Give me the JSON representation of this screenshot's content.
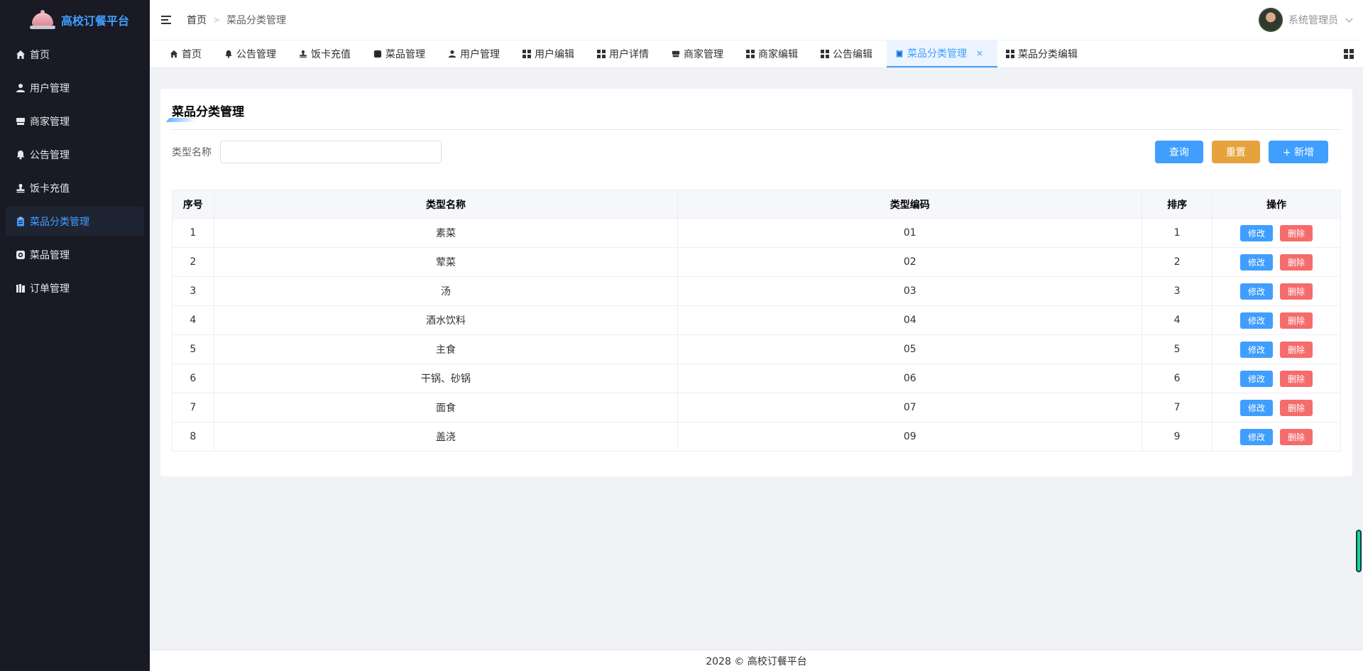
{
  "app": {
    "title": "高校订餐平台"
  },
  "sidebar": {
    "items": [
      {
        "label": "首页",
        "icon": "home-icon",
        "active": false
      },
      {
        "label": "用户管理",
        "icon": "user-icon",
        "active": false
      },
      {
        "label": "商家管理",
        "icon": "shop-icon",
        "active": false
      },
      {
        "label": "公告管理",
        "icon": "bell-icon",
        "active": false
      },
      {
        "label": "饭卡充值",
        "icon": "stamp-icon",
        "active": false
      },
      {
        "label": "菜品分类管理",
        "icon": "clipboard-icon",
        "active": true
      },
      {
        "label": "菜品管理",
        "icon": "dish-icon",
        "active": false
      },
      {
        "label": "订单管理",
        "icon": "order-icon",
        "active": false
      }
    ]
  },
  "header": {
    "breadcrumb": [
      "首页",
      "菜品分类管理"
    ],
    "user_name": "系统管理员"
  },
  "tabs": [
    {
      "label": "首页",
      "icon": "home-icon"
    },
    {
      "label": "公告管理",
      "icon": "bell-icon"
    },
    {
      "label": "饭卡充值",
      "icon": "stamp-icon"
    },
    {
      "label": "菜品管理",
      "icon": "dish-icon"
    },
    {
      "label": "用户管理",
      "icon": "user-icon"
    },
    {
      "label": "用户编辑",
      "icon": "grid-icon"
    },
    {
      "label": "用户详情",
      "icon": "grid-icon"
    },
    {
      "label": "商家管理",
      "icon": "shop-icon"
    },
    {
      "label": "商家编辑",
      "icon": "grid-icon"
    },
    {
      "label": "公告编辑",
      "icon": "grid-icon"
    },
    {
      "label": "菜品分类管理",
      "icon": "clipboard-icon",
      "active": true,
      "close": "×"
    },
    {
      "label": "菜品分类编辑",
      "icon": "grid-icon"
    }
  ],
  "page": {
    "title": "菜品分类管理",
    "search": {
      "label": "类型名称",
      "value": "",
      "placeholder": ""
    },
    "buttons": {
      "query": "查询",
      "reset": "重置",
      "add": "+ 新增"
    }
  },
  "table": {
    "columns": [
      "序号",
      "类型名称",
      "类型编码",
      "排序",
      "操作"
    ],
    "rows": [
      {
        "index": "1",
        "name": "素菜",
        "code": "01",
        "sort": "1"
      },
      {
        "index": "2",
        "name": "荤菜",
        "code": "02",
        "sort": "2"
      },
      {
        "index": "3",
        "name": "汤",
        "code": "03",
        "sort": "3"
      },
      {
        "index": "4",
        "name": "酒水饮料",
        "code": "04",
        "sort": "4"
      },
      {
        "index": "5",
        "name": "主食",
        "code": "05",
        "sort": "5"
      },
      {
        "index": "6",
        "name": "干锅、砂锅",
        "code": "06",
        "sort": "6"
      },
      {
        "index": "7",
        "name": "面食",
        "code": "07",
        "sort": "7"
      },
      {
        "index": "8",
        "name": "盖浇",
        "code": "09",
        "sort": "9"
      }
    ],
    "edit_label": "修改",
    "delete_label": "删除"
  },
  "footer": {
    "text": "2028 © 高校订餐平台"
  },
  "colors": {
    "accent": "#409eff",
    "warning": "#e6a23c",
    "danger": "#f56c6c",
    "sidebar_bg": "#191a23"
  }
}
